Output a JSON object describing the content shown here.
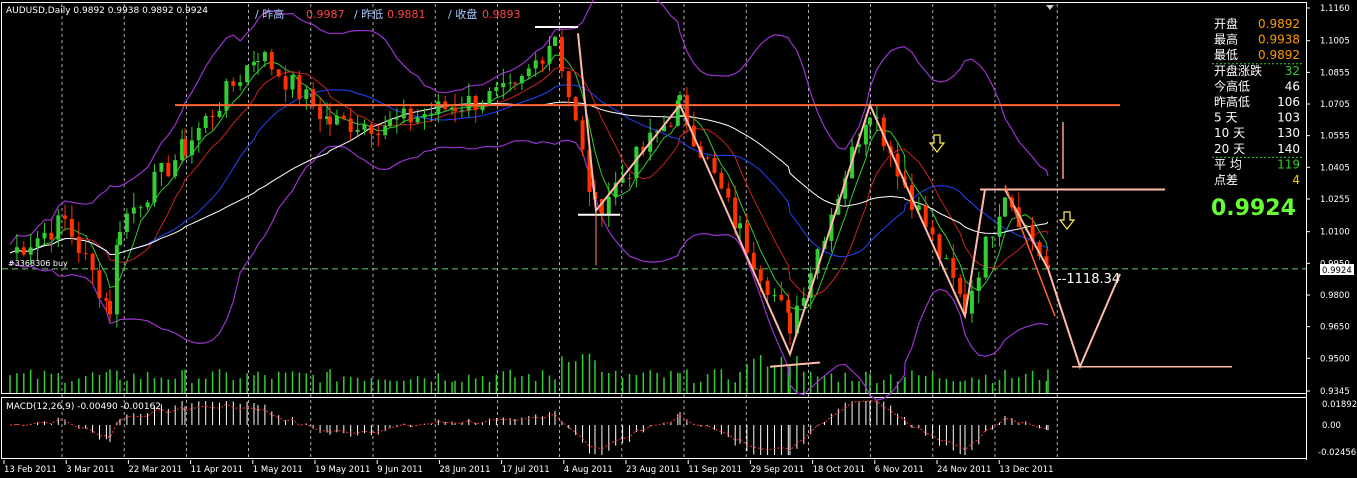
{
  "header": {
    "symbol": "AUDUSD,Daily  0.9892 0.9938 0.9892 0.9924",
    "prev_high_label": "/ 昨高",
    "prev_high_value": "0.9987",
    "prev_low_label": "/ 昨低",
    "prev_low_value": "0.9881",
    "prev_close_label": "/ 收盘",
    "prev_close_value": "0.9893"
  },
  "info_panel": {
    "rows": [
      {
        "key": "开盘",
        "value": "0.9892",
        "key_color": "#ffffff",
        "value_color": "#ff9900"
      },
      {
        "key": "最高",
        "value": "0.9938",
        "key_color": "#ffffff",
        "value_color": "#ff9900"
      },
      {
        "key": "最低",
        "value": "0.9892",
        "key_color": "#ffffff",
        "value_color": "#ff9900"
      },
      {
        "key": "开盘涨跌",
        "value": "32",
        "key_color": "#33cc33",
        "value_color": "#33cc33"
      },
      {
        "key": "今高低",
        "value": "46",
        "key_color": "#ffffff",
        "value_color": "#ffffff"
      },
      {
        "key": "昨高低",
        "value": "106",
        "key_color": "#ffffff",
        "value_color": "#ffffff"
      },
      {
        "key": "5    天",
        "value": "103",
        "key_color": "#ffffff",
        "value_color": "#ffffff"
      },
      {
        "key": "10  天",
        "value": "130",
        "key_color": "#ffffff",
        "value_color": "#ffffff"
      },
      {
        "key": "20  天",
        "value": "140",
        "key_color": "#ffffff",
        "value_color": "#ffffff"
      },
      {
        "key": "平  均",
        "value": "119",
        "key_color": "#ff3333",
        "value_color": "#33cc33"
      },
      {
        "key": "点差",
        "value": "4",
        "key_color": "#ffffff",
        "value_color": "#ffcc00"
      }
    ],
    "current_price": "0.9924"
  },
  "order_label": "#3368306 buy",
  "measure_label": "--1118.34",
  "price_axis": {
    "ticks": [
      "1.1160",
      "1.1005",
      "1.0855",
      "1.0705",
      "1.0555",
      "1.0405",
      "1.0255",
      "1.0100",
      "0.9950",
      "0.9800",
      "0.9650",
      "0.9500",
      "0.9345"
    ],
    "current_tag": "0.9924"
  },
  "macd": {
    "label": "MACD(12,26,9) -0.00490 -0.00162",
    "ticks": [
      "0.01892",
      "0.00",
      "-0.02456"
    ]
  },
  "x_axis": {
    "labels": [
      "13 Feb 2011",
      "3 Mar 2011",
      "22 Mar 2011",
      "11 Apr 2011",
      "1 May 2011",
      "19 May 2011",
      "9 Jun 2011",
      "28 Jun 2011",
      "17 Jul 2011",
      "4 Aug 2011",
      "23 Aug 2011",
      "11 Sep 2011",
      "29 Sep 2011",
      "18 Oct 2011",
      "6 Nov 2011",
      "24 Nov 2011",
      "13 Dec 2011"
    ]
  },
  "colors": {
    "background": "#000000",
    "bull": "#33cc33",
    "bear": "#ff3300",
    "bollinger": "#9933cc",
    "resistance": "#ff6633",
    "pattern": "#ffbbaa",
    "grid": "#ffffff"
  },
  "chart_data": {
    "type": "candlestick",
    "symbol": "AUDUSD",
    "timeframe": "Daily",
    "ylim": [
      0.9345,
      1.116
    ],
    "x_tick_labels": [
      "13 Feb 2011",
      "3 Mar 2011",
      "22 Mar 2011",
      "11 Apr 2011",
      "1 May 2011",
      "19 May 2011",
      "9 Jun 2011",
      "28 Jun 2011",
      "17 Jul 2011",
      "4 Aug 2011",
      "23 Aug 2011",
      "11 Sep 2011",
      "29 Sep 2011",
      "18 Oct 2011",
      "6 Nov 2011",
      "24 Nov 2011",
      "13 Dec 2011"
    ],
    "close_path": [
      {
        "date": "13 Feb 2011",
        "value": 1.0
      },
      {
        "date": "3 Mar 2011",
        "value": 1.015
      },
      {
        "date": "9 Mar 2011",
        "value": 0.974
      },
      {
        "date": "22 Mar 2011",
        "value": 1.014
      },
      {
        "date": "11 Apr 2011",
        "value": 1.05
      },
      {
        "date": "1 May 2011",
        "value": 1.095
      },
      {
        "date": "19 May 2011",
        "value": 1.062
      },
      {
        "date": "9 Jun 2011",
        "value": 1.061
      },
      {
        "date": "28 Jun 2011",
        "value": 1.07
      },
      {
        "date": "17 Jul 2011",
        "value": 1.076
      },
      {
        "date": "27 Jul 2011",
        "value": 1.104
      },
      {
        "date": "4 Aug 2011",
        "value": 1.02
      },
      {
        "date": "23 Aug 2011",
        "value": 1.07
      },
      {
        "date": "11 Sep 2011",
        "value": 1.01
      },
      {
        "date": "29 Sep 2011",
        "value": 0.966
      },
      {
        "date": "18 Oct 2011",
        "value": 1.07
      },
      {
        "date": "6 Nov 2011",
        "value": 1.033
      },
      {
        "date": "24 Nov 2011",
        "value": 0.974
      },
      {
        "date": "4 Dec 2011",
        "value": 1.03
      },
      {
        "date": "16 Dec 2011",
        "value": 0.9924
      }
    ],
    "last_close": 0.9924,
    "resistance_level": 1.07,
    "indicators": [
      "Bollinger Bands",
      "Moving Averages",
      "Volume",
      "MACD(12,26,9)"
    ],
    "macd": {
      "macd": -0.0049,
      "signal": -0.00162,
      "ylim": [
        -0.02456,
        0.01892
      ]
    }
  }
}
